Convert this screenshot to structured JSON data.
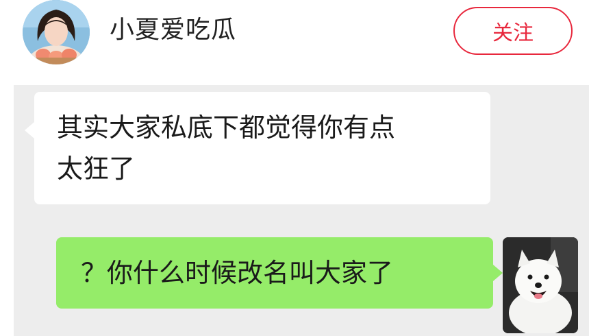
{
  "header": {
    "username": "小夏爱吃瓜",
    "follow_label": "关注"
  },
  "messages": [
    {
      "side": "left",
      "text_line1": "其实大家私底下都觉得你有点",
      "text_line2": "太狂了"
    },
    {
      "side": "right",
      "text": "？你什么时候改名叫大家了"
    }
  ],
  "icons": {
    "user_avatar": "woman-avatar-icon",
    "reply_avatar": "samoyed-dog-avatar-icon"
  },
  "colors": {
    "follow_accent": "#e8283d",
    "sent_bubble": "#95ec69",
    "received_bubble": "#ffffff",
    "chat_background": "#ededed"
  }
}
